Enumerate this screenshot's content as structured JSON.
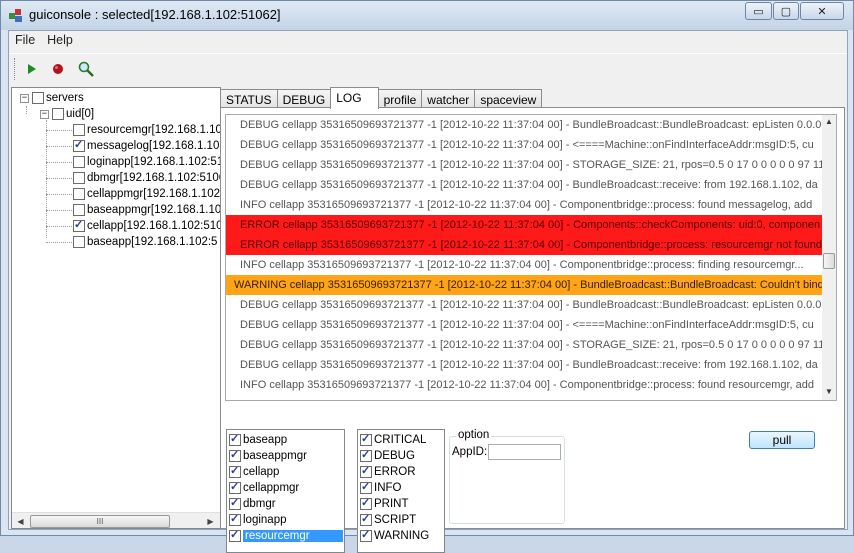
{
  "window": {
    "title": "guiconsole : selected[192.168.1.102:51062]",
    "minimize_glyph": "▭",
    "maximize_glyph": "▢",
    "close_glyph": "✕"
  },
  "menu": [
    "File",
    "Help"
  ],
  "toolbar": {
    "buttons": [
      "play-icon",
      "record-icon",
      "search-icon"
    ]
  },
  "tree": {
    "root": "servers",
    "group": "uid[0]",
    "items": [
      {
        "label": "resourcemgr[192.168.1.10",
        "checked": false
      },
      {
        "label": "messagelog[192.168.1.102",
        "checked": true
      },
      {
        "label": "loginapp[192.168.1.102:51",
        "checked": false
      },
      {
        "label": "dbmgr[192.168.1.102:5106",
        "checked": false
      },
      {
        "label": "cellappmgr[192.168.1.102:",
        "checked": false
      },
      {
        "label": "baseappmgr[192.168.1.10",
        "checked": false
      },
      {
        "label": "cellapp[192.168.1.102:510",
        "checked": true
      },
      {
        "label": "baseapp[192.168.1.102:5",
        "checked": false
      }
    ],
    "hscroll_grip": "III"
  },
  "tabs": [
    "STATUS",
    "DEBUG",
    "LOG",
    "profile",
    "watcher",
    "spaceview"
  ],
  "active_tab": "LOG",
  "log": {
    "rows": [
      {
        "level": "DEBUG",
        "text": "DEBUG cellapp      35316509693721377 -1 [2012-10-22 11:37:04 00] - BundleBroadcast::BundleBroadcast: epListen 0.0.0"
      },
      {
        "level": "DEBUG",
        "text": "DEBUG cellapp      35316509693721377 -1 [2012-10-22 11:37:04 00] - <====Machine::onFindInterfaceAddr:msgID:5, cu"
      },
      {
        "level": "DEBUG",
        "text": "DEBUG cellapp      35316509693721377 -1 [2012-10-22 11:37:04 00] - STORAGE_SIZE: 21, rpos=0.5 0 17 0 0 0 0 0 97 11"
      },
      {
        "level": "DEBUG",
        "text": "DEBUG cellapp      35316509693721377 -1 [2012-10-22 11:37:04 00] - BundleBroadcast::receive: from 192.168.1.102, da"
      },
      {
        "level": "INFO",
        "text": "  INFO cellapp      35316509693721377 -1 [2012-10-22 11:37:04 00] - Componentbridge::process: found messagelog, add"
      },
      {
        "level": "ERROR",
        "text": "ERROR cellapp      35316509693721377 -1 [2012-10-22 11:37:04 00] - Components::checkComponents: uid:0, componen"
      },
      {
        "level": "ERROR",
        "text": "ERROR cellapp      35316509693721377 -1 [2012-10-22 11:37:04 00] - Componentbridge::process: resourcemgr not found"
      },
      {
        "level": "INFO",
        "text": "  INFO cellapp      35316509693721377 -1 [2012-10-22 11:37:04 00] - Componentbridge::process: finding resourcemgr..."
      },
      {
        "level": "WARNING",
        "text": "WARNING cellapp      35316509693721377 -1 [2012-10-22 11:37:04 00] - BundleBroadcast::BundleBroadcast: Couldn't bind"
      },
      {
        "level": "DEBUG",
        "text": "DEBUG cellapp      35316509693721377 -1 [2012-10-22 11:37:04 00] - BundleBroadcast::BundleBroadcast: epListen 0.0.0"
      },
      {
        "level": "DEBUG",
        "text": "DEBUG cellapp      35316509693721377 -1 [2012-10-22 11:37:04 00] - <====Machine::onFindInterfaceAddr:msgID:5, cu"
      },
      {
        "level": "DEBUG",
        "text": "DEBUG cellapp      35316509693721377 -1 [2012-10-22 11:37:04 00] - STORAGE_SIZE: 21, rpos=0.5 0 17 0 0 0 0 0 97 11"
      },
      {
        "level": "DEBUG",
        "text": "DEBUG cellapp      35316509693721377 -1 [2012-10-22 11:37:04 00] - BundleBroadcast::receive: from 192.168.1.102, da"
      },
      {
        "level": "INFO",
        "text": "  INFO cellapp      35316509693721377 -1 [2012-10-22 11:37:04 00] - Componentbridge::process: found resourcemgr, add"
      }
    ],
    "scroll_up": "▲",
    "scroll_down": "▼"
  },
  "components_filter": [
    {
      "label": "baseapp",
      "checked": true,
      "selected": false
    },
    {
      "label": "baseappmgr",
      "checked": true,
      "selected": false
    },
    {
      "label": "cellapp",
      "checked": true,
      "selected": false
    },
    {
      "label": "cellappmgr",
      "checked": true,
      "selected": false
    },
    {
      "label": "dbmgr",
      "checked": true,
      "selected": false
    },
    {
      "label": "loginapp",
      "checked": true,
      "selected": false
    },
    {
      "label": "resourcemgr",
      "checked": true,
      "selected": true
    }
  ],
  "levels_filter": [
    {
      "label": "CRITICAL",
      "checked": true
    },
    {
      "label": "DEBUG",
      "checked": true
    },
    {
      "label": "ERROR",
      "checked": true
    },
    {
      "label": "INFO",
      "checked": true
    },
    {
      "label": "PRINT",
      "checked": true
    },
    {
      "label": "SCRIPT",
      "checked": true
    },
    {
      "label": "WARNING",
      "checked": true
    }
  ],
  "option": {
    "title": "option",
    "appid_label": "AppID:",
    "appid_value": ""
  },
  "pull_button": "pull",
  "colors": {
    "error": "#ff1a1a",
    "warning": "#ffa318",
    "selection": "#3399ff"
  }
}
